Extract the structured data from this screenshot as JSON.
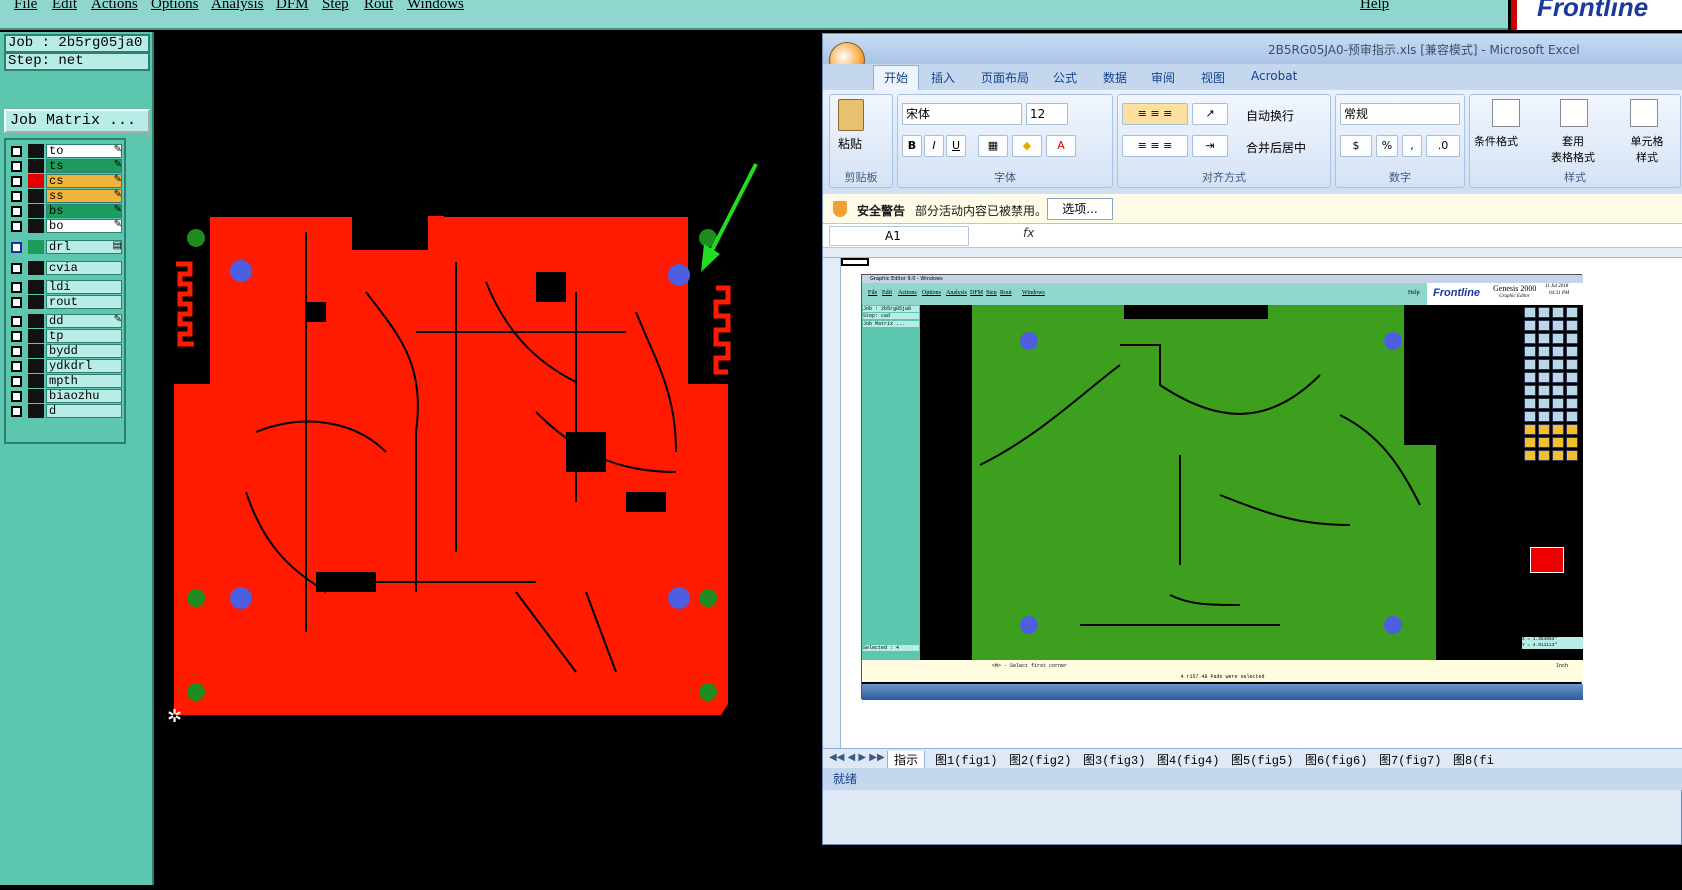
{
  "menubar": {
    "items": [
      "File",
      "Edit",
      "Actions",
      "Options",
      "Analysis",
      "DFM",
      "Step",
      "Rout",
      "Windows"
    ],
    "help": "Help",
    "logo": "Frontline"
  },
  "sidebar": {
    "job": "Job : 2b5rg05ja0",
    "step": "Step: net",
    "job_matrix": "Job Matrix ...",
    "layers": [
      {
        "name": "to",
        "color": "#ffffff",
        "swatch": "#111111"
      },
      {
        "name": "ts",
        "color": "#1e9c60",
        "swatch": "#111111"
      },
      {
        "name": "cs",
        "color": "#f0b43c",
        "swatch": "#e00000"
      },
      {
        "name": "ss",
        "color": "#f0b43c",
        "swatch": "#111111"
      },
      {
        "name": "bs",
        "color": "#1e9c60",
        "swatch": "#111111"
      },
      {
        "name": "bo",
        "color": "#ffffff",
        "swatch": "#111111"
      },
      {
        "name": "drl",
        "color": "#b8ece6",
        "swatch": "#1e9c60"
      },
      {
        "name": "cvia",
        "color": "#b8ece6",
        "swatch": "#111111"
      },
      {
        "name": "ldi",
        "color": "#b8ece6",
        "swatch": "#111111"
      },
      {
        "name": "rout",
        "color": "#b8ece6",
        "swatch": "#111111"
      },
      {
        "name": "dd",
        "color": "#b8ece6",
        "swatch": "#111111"
      },
      {
        "name": "tp",
        "color": "#b8ece6",
        "swatch": "#111111"
      },
      {
        "name": "bydd",
        "color": "#b8ece6",
        "swatch": "#111111"
      },
      {
        "name": "ydkdrl",
        "color": "#b8ece6",
        "swatch": "#111111"
      },
      {
        "name": "mpth",
        "color": "#b8ece6",
        "swatch": "#111111"
      },
      {
        "name": "biaozhu",
        "color": "#b8ece6",
        "swatch": "#111111"
      },
      {
        "name": "d",
        "color": "#b8ece6",
        "swatch": "#111111"
      }
    ]
  },
  "board": {
    "copper_color": "#ff1a00",
    "hole_color": "#4d5fe0",
    "npth_color": "#1e8c1e",
    "arrow_color": "#22dd22"
  },
  "excel": {
    "title": "2B5RG05JA0-预审指示.xls  [兼容模式] - Microsoft Excel",
    "tabs": [
      "开始",
      "插入",
      "页面布局",
      "公式",
      "数据",
      "审阅",
      "视图",
      "Acrobat"
    ],
    "ribbon": {
      "paste": "粘贴",
      "clipboard": "剪贴板",
      "font_name": "宋体",
      "font_size": "12",
      "font_group": "字体",
      "wrap": "自动换行",
      "merge": "合并后居中",
      "align_group": "对齐方式",
      "number_format": "常规",
      "number_group": "数字",
      "cond_format": "条件格式",
      "table_format": "套用\n表格格式",
      "cell_style": "单元格\n样式",
      "style_group": "样式"
    },
    "security": {
      "title": "安全警告",
      "message": "部分活动内容已被禁用。",
      "button": "选项..."
    },
    "namebox": "A1",
    "fx": "fx",
    "sheet_tabs": [
      "指示",
      "图1(fig1)",
      "图2(fig2)",
      "图3(fig3)",
      "图4(fig4)",
      "图5(fig5)",
      "图6(fig6)",
      "图7(fig7)",
      "图8(fi"
    ],
    "status": "就绪"
  },
  "embedded": {
    "title": "Graphic Editor 9.0 - Windows",
    "menu": [
      "File",
      "Edit",
      "Actions",
      "Options",
      "Analysis",
      "DFM",
      "Step",
      "Rout",
      "Windows"
    ],
    "help": "Help",
    "logo": "Frontline",
    "product": "Genesis 2000",
    "product_sub": "Graphic Editor",
    "date": "11 Jul 2018",
    "time": "04:31 PM",
    "job": "Job : 2b5rg05ja0",
    "step": "Step: cad",
    "job_matrix": "Job Matrix ...",
    "selected": "Selected : 4",
    "prompt": "<M> - Select first corner",
    "message": "4 r157.48 Pads were selected",
    "unit": "Inch",
    "xcoord": "X = 1.354953\"",
    "ycoord": "Y = 4.011113\"",
    "board_color": "#3ca01e"
  }
}
